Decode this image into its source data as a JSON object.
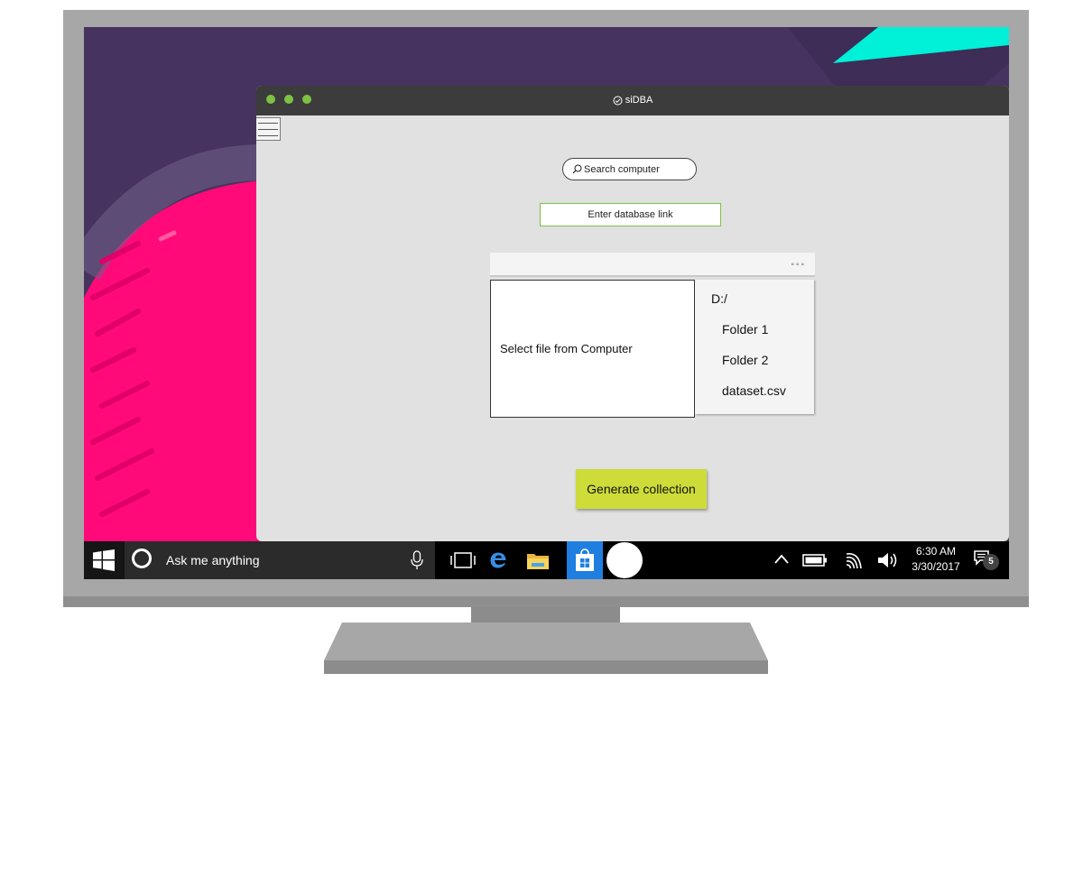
{
  "app": {
    "title": "siDBA",
    "search_placeholder": "Search computer",
    "db_link_placeholder": "Enter database link",
    "browser_menu": "◦◦◦",
    "file_select_label": "Select file from Computer",
    "file_tree": [
      "D:/",
      "Folder 1",
      "Folder 2",
      "dataset.csv"
    ],
    "generate_label": "Generate collection",
    "accent_color": "#7dc242",
    "button_color": "#cddc39"
  },
  "taskbar": {
    "search_placeholder": "Ask me anything",
    "time": "6:30 AM",
    "date": "3/30/2017",
    "notification_count": "5",
    "icons": [
      "windows-start-icon",
      "cortana-icon",
      "microphone-icon",
      "task-view-icon",
      "edge-icon",
      "file-explorer-icon",
      "store-icon",
      "chevron-up-icon",
      "battery-icon",
      "wifi-icon",
      "volume-icon",
      "action-center-icon"
    ],
    "store_color": "#1f7fe0"
  }
}
